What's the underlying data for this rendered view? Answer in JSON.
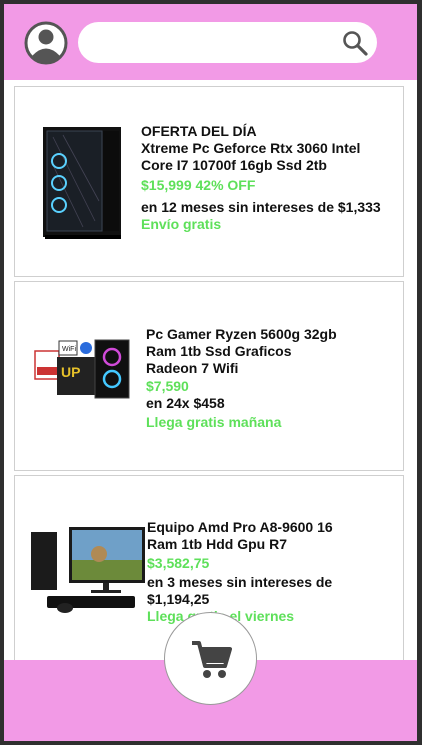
{
  "search": {
    "placeholder": ""
  },
  "products": [
    {
      "badge": "OFERTA DEL DÍA",
      "title": "Xtreme Pc Geforce Rtx 3060 Intel Core I7 10700f 16gb Ssd 2tb",
      "price": "$15,999 42% OFF",
      "installments": "en 12 meses sin intereses de $1,333",
      "shipping": "Envío gratis"
    },
    {
      "title": "Pc Gamer Ryzen 5600g 32gb Ram 1tb Ssd Graficos Radeon 7 Wifi",
      "price": "$7,590",
      "installments": "en 24x $458",
      "shipping": "Llega gratis mañana"
    },
    {
      "title": "Equipo Amd Pro A8-9600 16 Ram 1tb Hdd Gpu R7",
      "price": "$3,582,75",
      "installments": "en 3 meses sin intereses de $1,194,25",
      "shipping": "Llega gratis el viernes"
    }
  ],
  "icons": {
    "avatar": "user-avatar-icon",
    "search": "search-icon",
    "cart": "shopping-cart-icon"
  },
  "colors": {
    "header": "#f29ae6",
    "accent_green": "#5ee05a"
  }
}
